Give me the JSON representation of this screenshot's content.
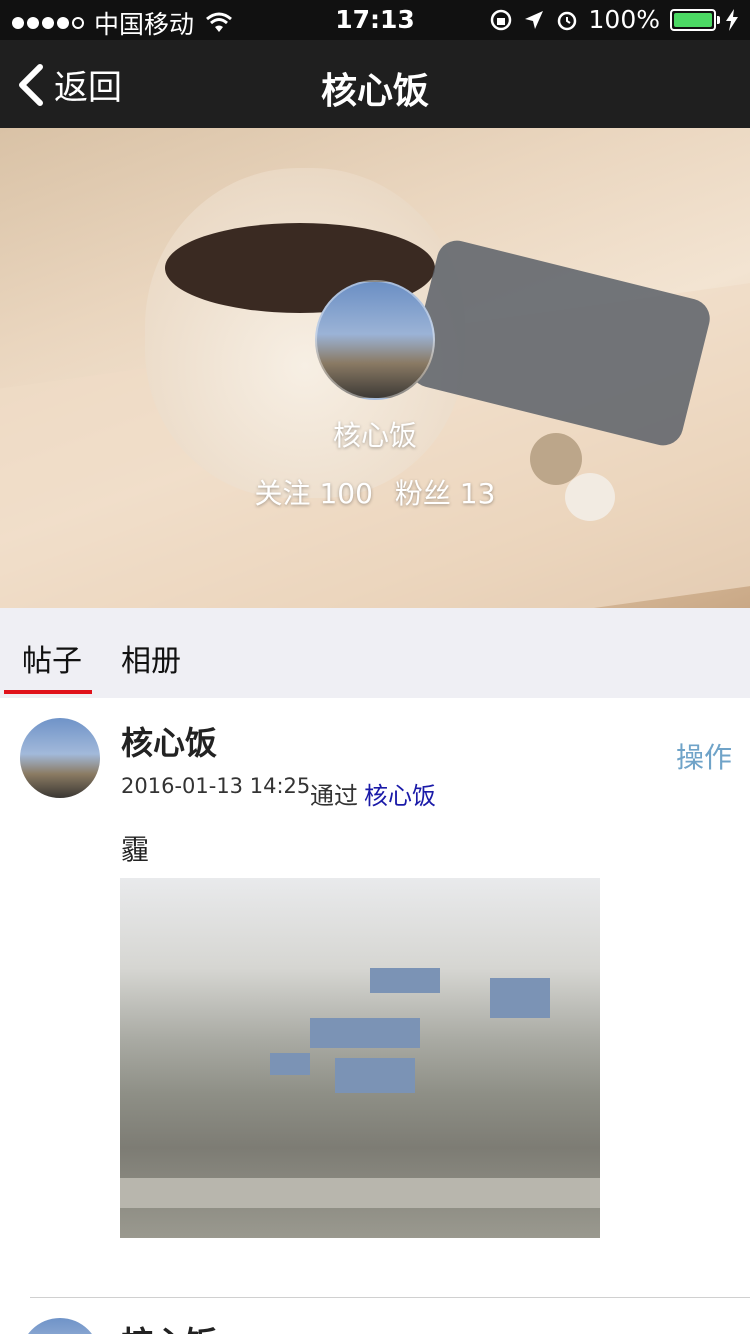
{
  "status_bar": {
    "carrier": "中国移动",
    "time": "17:13",
    "battery": "100%",
    "battery_level": 1.0,
    "icons": [
      "signal-dots-icon",
      "wifi-icon",
      "rotation-lock-icon",
      "location-arrow-icon",
      "alarm-icon",
      "battery-icon",
      "charging-bolt-icon"
    ]
  },
  "navbar": {
    "back_label": "返回",
    "title": "核心饭"
  },
  "profile": {
    "name": "核心饭",
    "following_label": "关注 100",
    "followers_label": "粉丝 13"
  },
  "tabs": [
    {
      "label": "帖子",
      "active": true
    },
    {
      "label": "相册",
      "active": false
    }
  ],
  "posts": [
    {
      "author": "核心饭",
      "action": "操作",
      "timestamp": "2016-01-13 14:25",
      "via_label": "通过",
      "via_source": "核心饭",
      "text": "霾"
    },
    {
      "author": "核心饭"
    }
  ],
  "colors": {
    "accent_underline": "#e0121b",
    "action_text": "#6fa3c8",
    "link_text": "#1a1aa8",
    "navbar_bg": "#1f1f1f",
    "tabs_bg": "#efeff4"
  }
}
